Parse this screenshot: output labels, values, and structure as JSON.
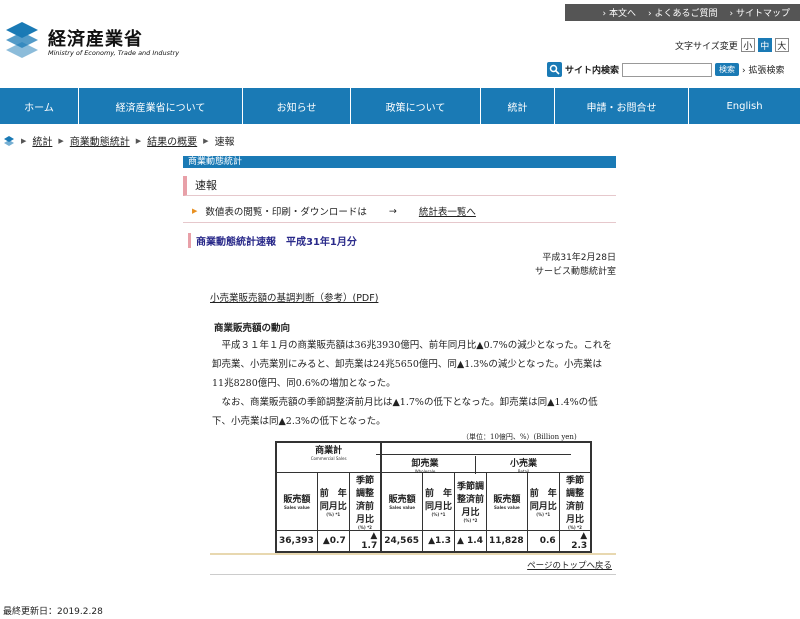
{
  "header": {
    "top_links": [
      "本文へ",
      "よくあるご質問",
      "サイトマップ"
    ],
    "logo_ja": "経済産業省",
    "logo_en": "Ministry of Economy, Trade and Industry",
    "font_size_label": "文字サイズ変更",
    "font_sizes": [
      "小",
      "中",
      "大"
    ],
    "search_label": "サイト内検索",
    "search_button": "検索",
    "advanced_search": "拡張検索"
  },
  "nav": [
    "ホーム",
    "経済産業省について",
    "お知らせ",
    "政策について",
    "統計",
    "申請・お問合せ",
    "English"
  ],
  "breadcrumb": [
    "統計",
    "商業動態統計",
    "結果の概要",
    "速報"
  ],
  "content": {
    "category_header": "商業動態統計",
    "page_title": "速報",
    "download_text": "数値表の閲覧・印刷・ダウンロードは",
    "download_arrow": "→",
    "download_link": "統計表一覧へ",
    "sub_title": "商業動態統計速報　平成31年1月分",
    "date": "平成31年2月28日",
    "office": "サービス動態統計室",
    "pdf_link": "小売業販売額の基調判断（参考）(PDF)",
    "section_heading": "商業販売額の動向",
    "paragraph1": "　平成３１年１月の商業販売額は36兆3930億円、前年同月比▲0.7%の減少となった。これを卸売業、小売業別にみると、卸売業は24兆5650億円、同▲1.3%の減少となった。小売業は11兆8280億円、同0.6%の増加となった。",
    "paragraph2": "　なお、商業販売額の季節調整済前月比は▲1.7%の低下となった。卸売業は同▲1.4%の低下、小売業は同▲2.3%の低下となった。",
    "unit": "（単位：10億円、%）(Billion yen)",
    "page_top": "ページのトップへ戻る"
  },
  "summary_table": {
    "groups": [
      {
        "name": "商業計",
        "name_en": "Commercial Sales",
        "values": [
          "36,393",
          "▲0.7",
          "▲ 1.7"
        ]
      },
      {
        "name": "卸売業",
        "name_en": "Wholesale",
        "values": [
          "24,565",
          "▲1.3",
          "▲ 1.4"
        ]
      },
      {
        "name": "小売業",
        "name_en": "Retail",
        "values": [
          "11,828",
          "0.6",
          "▲ 2.3"
        ]
      }
    ],
    "col_headers": [
      "販売額",
      "前　年同月比",
      "季節調整済前月比"
    ],
    "col_sub": [
      "Sales value",
      "(%) *1",
      "(%) *2"
    ]
  },
  "footer": {
    "last_updated": "最終更新日：2019.2.28"
  }
}
